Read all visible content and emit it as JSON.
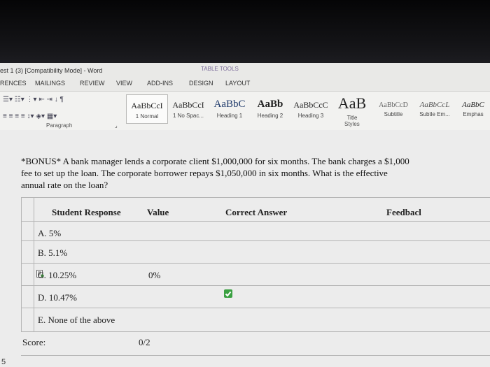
{
  "window": {
    "title": "est 1 (3) [Compatibility Mode] - Word",
    "context_tools": "TABLE TOOLS"
  },
  "tabs": [
    {
      "label": "RENCES"
    },
    {
      "label": "MAILINGS"
    },
    {
      "label": "REVIEW"
    },
    {
      "label": "VIEW"
    },
    {
      "label": "ADD-INS"
    },
    {
      "label": "DESIGN"
    },
    {
      "label": "LAYOUT"
    }
  ],
  "ribbon": {
    "paragraph_label": "Paragraph",
    "styles_label": "Styles",
    "styles": [
      {
        "preview": "AaBbCcI",
        "name": "1 Normal"
      },
      {
        "preview": "AaBbCcI",
        "name": "1 No Spac..."
      },
      {
        "preview": "AaBbC",
        "name": "Heading 1"
      },
      {
        "preview": "AaBb",
        "name": "Heading 2"
      },
      {
        "preview": "AaBbCcC",
        "name": "Heading 3"
      },
      {
        "preview": "AaB",
        "name": "Title"
      },
      {
        "preview": "AaBbCcD",
        "name": "Subtitle"
      },
      {
        "preview": "AaBbCcL",
        "name": "Subtle Em..."
      },
      {
        "preview": "AaBbC",
        "name": "Emphas"
      }
    ]
  },
  "question": {
    "text": "*BONUS* A bank manager lends a corporate client $1,000,000 for six months. The bank charges a $1,000 fee to set up the loan. The corporate borrower repays $1,050,000 in six months. What is the effective annual rate on the loan?"
  },
  "table": {
    "headers": {
      "response": "Student Response",
      "value": "Value",
      "correct": "Correct Answer",
      "feedback": "Feedbacl"
    },
    "options": [
      {
        "label": "A. 5%",
        "value": "",
        "correct": false
      },
      {
        "label": "B. 5.1%",
        "value": "",
        "correct": false
      },
      {
        "label": "C. 10.25%",
        "value": "0%",
        "correct": false,
        "selected": true
      },
      {
        "label": "D. 10.47%",
        "value": "",
        "correct": true
      },
      {
        "label": "E. None of the above",
        "value": "",
        "correct": false
      }
    ],
    "score_label": "Score:",
    "score_value": "0/2"
  },
  "page_number": "5",
  "colors": {
    "check_green": "#3aa041",
    "ribbon_bg": "#f2f2f0",
    "document_bg": "#ececec"
  }
}
